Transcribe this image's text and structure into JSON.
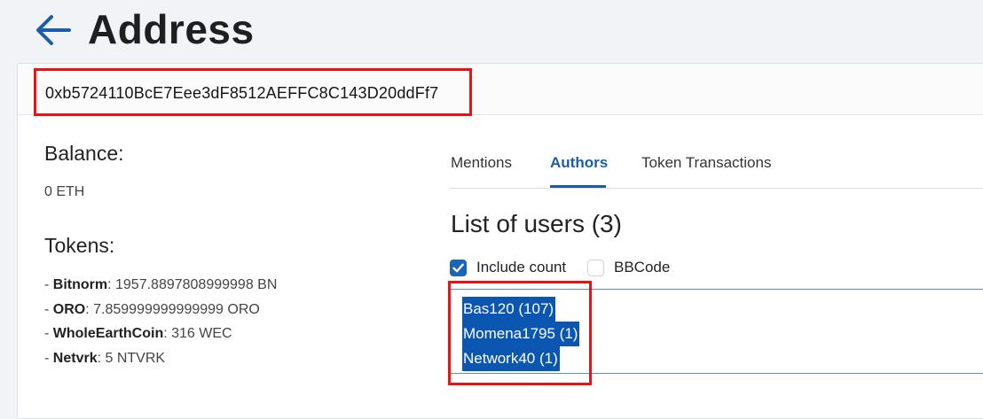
{
  "header": {
    "back_icon": "arrow-left-icon",
    "title": "Address"
  },
  "address": "0xb5724110BcE7Eee3dF8512AEFFC8C143D20ddFf7",
  "balance": {
    "heading": "Balance:",
    "value": "0 ETH"
  },
  "tokens": {
    "heading": "Tokens:",
    "items": [
      {
        "name": "Bitnorm",
        "amount": ": 1957.8897808999998 BN"
      },
      {
        "name": "ORO",
        "amount": ": 7.859999999999999 ORO"
      },
      {
        "name": "WholeEarthCoin",
        "amount": ": 316 WEC"
      },
      {
        "name": "Netvrk",
        "amount": ": 5 NTVRK"
      }
    ]
  },
  "tabs": [
    {
      "label": "Mentions",
      "active": false
    },
    {
      "label": "Authors",
      "active": true
    },
    {
      "label": "Token Transactions",
      "active": false
    }
  ],
  "users_section": {
    "heading": "List of users (3)",
    "include_count": {
      "label": "Include count",
      "checked": true
    },
    "bbcode": {
      "label": "BBCode",
      "checked": false
    },
    "users": [
      "Bas120 (107)",
      "Momena1795 (1)",
      "Network40 (1)"
    ]
  },
  "colors": {
    "accent": "#1a5ea8",
    "selection": "#0b56b0",
    "highlight_box": "#ee1111"
  }
}
